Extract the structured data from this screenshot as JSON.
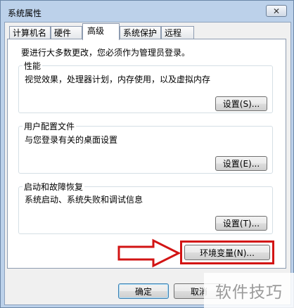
{
  "window": {
    "title": "系统属性",
    "close_glyph": "✕"
  },
  "tabs": [
    {
      "label": "计算机名"
    },
    {
      "label": "硬件"
    },
    {
      "label": "高级"
    },
    {
      "label": "系统保护"
    },
    {
      "label": "远程"
    }
  ],
  "active_tab": "高级",
  "intro": "要进行大多数更改，您必须作为管理员登录。",
  "performance": {
    "title": "性能",
    "description": "视觉效果，处理器计划，内存使用，以及虚拟内存",
    "button": "设置(S)..."
  },
  "user_profiles": {
    "title": "用户配置文件",
    "description": "与您登录有关的桌面设置",
    "button": "设置(E)..."
  },
  "startup_recovery": {
    "title": "启动和故障恢复",
    "description": "系统启动、系统失败和调试信息",
    "button": "设置(T)..."
  },
  "env_button": "环境变量(N)...",
  "footer": {
    "ok": "确定",
    "cancel": "取消"
  },
  "annotation": {
    "color": "#d21414"
  },
  "watermark": "软件技巧"
}
